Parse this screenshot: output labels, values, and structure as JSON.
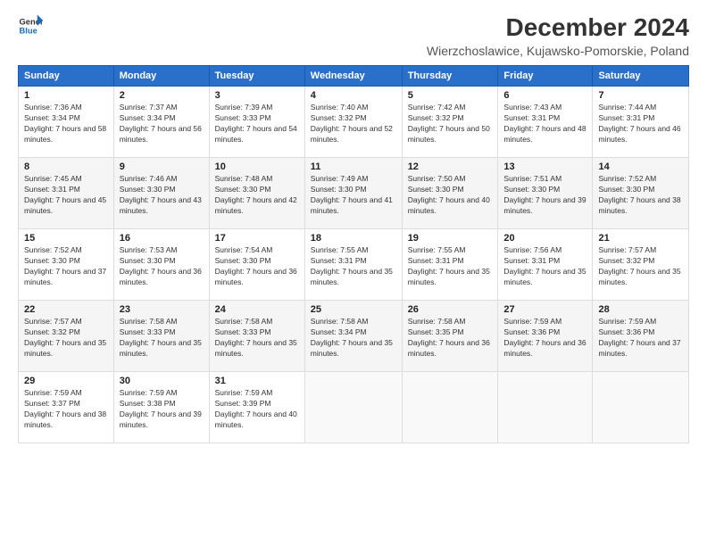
{
  "header": {
    "logo_line1": "General",
    "logo_line2": "Blue",
    "title": "December 2024",
    "subtitle": "Wierzchoslawice, Kujawsko-Pomorskie, Poland"
  },
  "columns": [
    "Sunday",
    "Monday",
    "Tuesday",
    "Wednesday",
    "Thursday",
    "Friday",
    "Saturday"
  ],
  "weeks": [
    [
      {
        "day": "1",
        "rise": "Sunrise: 7:36 AM",
        "set": "Sunset: 3:34 PM",
        "daylight": "Daylight: 7 hours and 58 minutes."
      },
      {
        "day": "2",
        "rise": "Sunrise: 7:37 AM",
        "set": "Sunset: 3:34 PM",
        "daylight": "Daylight: 7 hours and 56 minutes."
      },
      {
        "day": "3",
        "rise": "Sunrise: 7:39 AM",
        "set": "Sunset: 3:33 PM",
        "daylight": "Daylight: 7 hours and 54 minutes."
      },
      {
        "day": "4",
        "rise": "Sunrise: 7:40 AM",
        "set": "Sunset: 3:32 PM",
        "daylight": "Daylight: 7 hours and 52 minutes."
      },
      {
        "day": "5",
        "rise": "Sunrise: 7:42 AM",
        "set": "Sunset: 3:32 PM",
        "daylight": "Daylight: 7 hours and 50 minutes."
      },
      {
        "day": "6",
        "rise": "Sunrise: 7:43 AM",
        "set": "Sunset: 3:31 PM",
        "daylight": "Daylight: 7 hours and 48 minutes."
      },
      {
        "day": "7",
        "rise": "Sunrise: 7:44 AM",
        "set": "Sunset: 3:31 PM",
        "daylight": "Daylight: 7 hours and 46 minutes."
      }
    ],
    [
      {
        "day": "8",
        "rise": "Sunrise: 7:45 AM",
        "set": "Sunset: 3:31 PM",
        "daylight": "Daylight: 7 hours and 45 minutes."
      },
      {
        "day": "9",
        "rise": "Sunrise: 7:46 AM",
        "set": "Sunset: 3:30 PM",
        "daylight": "Daylight: 7 hours and 43 minutes."
      },
      {
        "day": "10",
        "rise": "Sunrise: 7:48 AM",
        "set": "Sunset: 3:30 PM",
        "daylight": "Daylight: 7 hours and 42 minutes."
      },
      {
        "day": "11",
        "rise": "Sunrise: 7:49 AM",
        "set": "Sunset: 3:30 PM",
        "daylight": "Daylight: 7 hours and 41 minutes."
      },
      {
        "day": "12",
        "rise": "Sunrise: 7:50 AM",
        "set": "Sunset: 3:30 PM",
        "daylight": "Daylight: 7 hours and 40 minutes."
      },
      {
        "day": "13",
        "rise": "Sunrise: 7:51 AM",
        "set": "Sunset: 3:30 PM",
        "daylight": "Daylight: 7 hours and 39 minutes."
      },
      {
        "day": "14",
        "rise": "Sunrise: 7:52 AM",
        "set": "Sunset: 3:30 PM",
        "daylight": "Daylight: 7 hours and 38 minutes."
      }
    ],
    [
      {
        "day": "15",
        "rise": "Sunrise: 7:52 AM",
        "set": "Sunset: 3:30 PM",
        "daylight": "Daylight: 7 hours and 37 minutes."
      },
      {
        "day": "16",
        "rise": "Sunrise: 7:53 AM",
        "set": "Sunset: 3:30 PM",
        "daylight": "Daylight: 7 hours and 36 minutes."
      },
      {
        "day": "17",
        "rise": "Sunrise: 7:54 AM",
        "set": "Sunset: 3:30 PM",
        "daylight": "Daylight: 7 hours and 36 minutes."
      },
      {
        "day": "18",
        "rise": "Sunrise: 7:55 AM",
        "set": "Sunset: 3:31 PM",
        "daylight": "Daylight: 7 hours and 35 minutes."
      },
      {
        "day": "19",
        "rise": "Sunrise: 7:55 AM",
        "set": "Sunset: 3:31 PM",
        "daylight": "Daylight: 7 hours and 35 minutes."
      },
      {
        "day": "20",
        "rise": "Sunrise: 7:56 AM",
        "set": "Sunset: 3:31 PM",
        "daylight": "Daylight: 7 hours and 35 minutes."
      },
      {
        "day": "21",
        "rise": "Sunrise: 7:57 AM",
        "set": "Sunset: 3:32 PM",
        "daylight": "Daylight: 7 hours and 35 minutes."
      }
    ],
    [
      {
        "day": "22",
        "rise": "Sunrise: 7:57 AM",
        "set": "Sunset: 3:32 PM",
        "daylight": "Daylight: 7 hours and 35 minutes."
      },
      {
        "day": "23",
        "rise": "Sunrise: 7:58 AM",
        "set": "Sunset: 3:33 PM",
        "daylight": "Daylight: 7 hours and 35 minutes."
      },
      {
        "day": "24",
        "rise": "Sunrise: 7:58 AM",
        "set": "Sunset: 3:33 PM",
        "daylight": "Daylight: 7 hours and 35 minutes."
      },
      {
        "day": "25",
        "rise": "Sunrise: 7:58 AM",
        "set": "Sunset: 3:34 PM",
        "daylight": "Daylight: 7 hours and 35 minutes."
      },
      {
        "day": "26",
        "rise": "Sunrise: 7:58 AM",
        "set": "Sunset: 3:35 PM",
        "daylight": "Daylight: 7 hours and 36 minutes."
      },
      {
        "day": "27",
        "rise": "Sunrise: 7:59 AM",
        "set": "Sunset: 3:36 PM",
        "daylight": "Daylight: 7 hours and 36 minutes."
      },
      {
        "day": "28",
        "rise": "Sunrise: 7:59 AM",
        "set": "Sunset: 3:36 PM",
        "daylight": "Daylight: 7 hours and 37 minutes."
      }
    ],
    [
      {
        "day": "29",
        "rise": "Sunrise: 7:59 AM",
        "set": "Sunset: 3:37 PM",
        "daylight": "Daylight: 7 hours and 38 minutes."
      },
      {
        "day": "30",
        "rise": "Sunrise: 7:59 AM",
        "set": "Sunset: 3:38 PM",
        "daylight": "Daylight: 7 hours and 39 minutes."
      },
      {
        "day": "31",
        "rise": "Sunrise: 7:59 AM",
        "set": "Sunset: 3:39 PM",
        "daylight": "Daylight: 7 hours and 40 minutes."
      },
      null,
      null,
      null,
      null
    ]
  ]
}
